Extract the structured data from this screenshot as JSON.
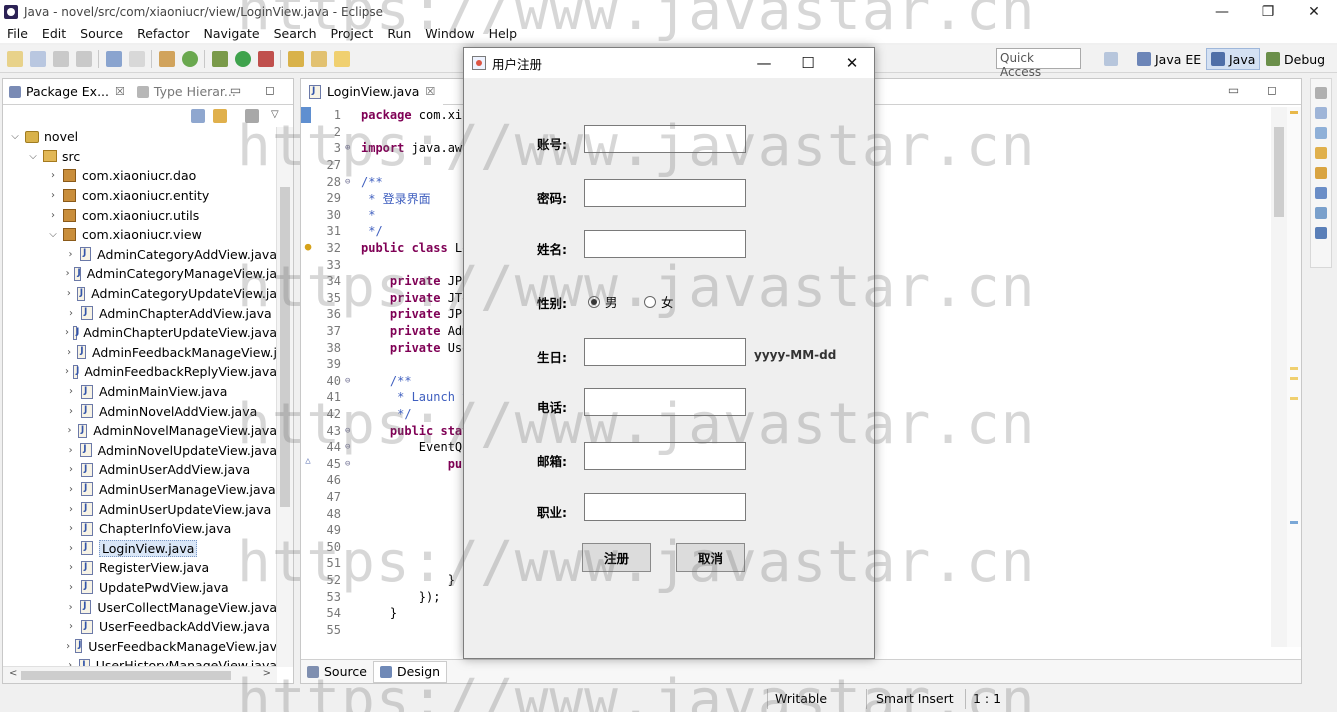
{
  "window": {
    "title": "Java - novel/src/com/xiaoniucr/view/LoginView.java - Eclipse",
    "minimize": "—",
    "restore": "❐",
    "close": "✕"
  },
  "menu": [
    "File",
    "Edit",
    "Source",
    "Refactor",
    "Navigate",
    "Search",
    "Project",
    "Run",
    "Window",
    "Help"
  ],
  "toolbar": {
    "quick_access": "Quick Access",
    "perspectives": [
      "Java EE",
      "Java",
      "Debug"
    ]
  },
  "package_explorer": {
    "tab_label": "Package Ex...",
    "type_hierarchy_label": "Type Hierar...",
    "close_glyph": "☒",
    "minmax": "▭ ◻",
    "project": "novel",
    "src": "src",
    "packages": [
      "com.xiaoniucr.dao",
      "com.xiaoniucr.entity",
      "com.xiaoniucr.utils",
      "com.xiaoniucr.view"
    ],
    "files": [
      "AdminCategoryAddView.java",
      "AdminCategoryManageView.ja",
      "AdminCategoryUpdateView.ja",
      "AdminChapterAddView.java",
      "AdminChapterUpdateView.java",
      "AdminFeedbackManageView.j",
      "AdminFeedbackReplyView.java",
      "AdminMainView.java",
      "AdminNovelAddView.java",
      "AdminNovelManageView.java",
      "AdminNovelUpdateView.java",
      "AdminUserAddView.java",
      "AdminUserManageView.java",
      "AdminUserUpdateView.java",
      "ChapterInfoView.java",
      "LoginView.java",
      "RegisterView.java",
      "UpdatePwdView.java",
      "UserCollectManageView.java",
      "UserFeedbackAddView.java",
      "UserFeedbackManageView.jav",
      "UserHistoryManageView.java"
    ],
    "selected": "LoginView.java"
  },
  "editor": {
    "tab_label": "LoginView.java",
    "close_glyph": "☒",
    "bottom_tabs": [
      "Source",
      "Design"
    ],
    "lines": [
      {
        "n": "1",
        "fold": "",
        "kw": "package",
        "text": " com.xia"
      },
      {
        "n": "2",
        "fold": "",
        "kw": "",
        "text": ""
      },
      {
        "n": "3",
        "fold": "⊕",
        "kw": "import",
        "text": " java.awt"
      },
      {
        "n": "27",
        "fold": "",
        "kw": "",
        "text": ""
      },
      {
        "n": "28",
        "fold": "⊖",
        "kw": "",
        "cm": "/**"
      },
      {
        "n": "29",
        "fold": "",
        "kw": "",
        "cm": " * 登录界面"
      },
      {
        "n": "30",
        "fold": "",
        "kw": "",
        "cm": " *"
      },
      {
        "n": "31",
        "fold": "",
        "kw": "",
        "cm": " */"
      },
      {
        "n": "32",
        "fold": "",
        "kw": "public class",
        "text": " Lo"
      },
      {
        "n": "33",
        "fold": "",
        "kw": "",
        "text": ""
      },
      {
        "n": "34",
        "fold": "",
        "kw": "    private",
        "text": " JPa"
      },
      {
        "n": "35",
        "fold": "",
        "kw": "    private",
        "text": " JTe"
      },
      {
        "n": "36",
        "fold": "",
        "kw": "    private",
        "text": " JPa"
      },
      {
        "n": "37",
        "fold": "",
        "kw": "    private",
        "text": " Adm"
      },
      {
        "n": "38",
        "fold": "",
        "kw": "    private",
        "text": " Use"
      },
      {
        "n": "39",
        "fold": "",
        "kw": "",
        "text": ""
      },
      {
        "n": "40",
        "fold": "⊖",
        "kw": "",
        "cm": "    /**"
      },
      {
        "n": "41",
        "fold": "",
        "kw": "",
        "cm": "     * Launch t"
      },
      {
        "n": "42",
        "fold": "",
        "kw": "",
        "cm": "     */"
      },
      {
        "n": "43",
        "fold": "⊖",
        "kw": "    public stat",
        "text": ""
      },
      {
        "n": "44",
        "fold": "⊖",
        "kw": "",
        "text": "        EventQu"
      },
      {
        "n": "45",
        "fold": "⊖",
        "kw": "            pub",
        "text": ""
      },
      {
        "n": "46",
        "fold": "",
        "kw": "",
        "text": ""
      },
      {
        "n": "47",
        "fold": "",
        "kw": "",
        "text": ""
      },
      {
        "n": "48",
        "fold": "",
        "kw": "",
        "text": ""
      },
      {
        "n": "49",
        "fold": "",
        "kw": "",
        "text": ""
      },
      {
        "n": "50",
        "fold": "",
        "kw": "",
        "text": ""
      },
      {
        "n": "51",
        "fold": "",
        "kw": "",
        "text": ""
      },
      {
        "n": "52",
        "fold": "",
        "kw": "",
        "text": "            }"
      },
      {
        "n": "53",
        "fold": "",
        "kw": "",
        "text": "        });"
      },
      {
        "n": "54",
        "fold": "",
        "kw": "",
        "text": "    }"
      },
      {
        "n": "55",
        "fold": "",
        "kw": "",
        "text": ""
      }
    ]
  },
  "status": {
    "writable": "Writable",
    "insert_mode": "Smart Insert",
    "position": "1 : 1"
  },
  "dialog": {
    "title": "用户注册",
    "minimize": "—",
    "maximize": "☐",
    "close": "✕",
    "fields": {
      "account": "账号:",
      "password": "密码:",
      "name": "姓名:",
      "gender": "性别:",
      "birthday": "生日:",
      "phone": "电话:",
      "email": "邮箱:",
      "job": "职业:"
    },
    "gender_male": "男",
    "gender_female": "女",
    "birthday_hint": "yyyy-MM-dd",
    "register_button": "注册",
    "cancel_button": "取消"
  },
  "watermark": "https://www.javastar.cn",
  "colors": {
    "keyword": "#7f0055",
    "comment": "#3f5fbf",
    "selection": "#d9e6f7"
  }
}
